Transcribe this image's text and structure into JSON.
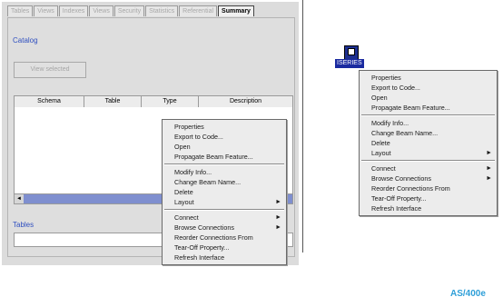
{
  "tabs": [
    {
      "label": "Tables",
      "active": false
    },
    {
      "label": "Views",
      "active": false
    },
    {
      "label": "Indexes",
      "active": false
    },
    {
      "label": "Views",
      "active": false
    },
    {
      "label": "Security",
      "active": false
    },
    {
      "label": "Statistics",
      "active": false
    },
    {
      "label": "Referential",
      "active": false
    },
    {
      "label": "Summary",
      "active": true
    }
  ],
  "panel": {
    "catalog_label": "Catalog",
    "view_selected_button": "View selected",
    "columns": [
      "Schema",
      "Table",
      "Type",
      "Description"
    ],
    "tables_label": "Tables",
    "tables_value": ""
  },
  "left_menu": {
    "groups": [
      [
        "Properties",
        "Export to Code...",
        "Open",
        "Propagate Beam Feature..."
      ],
      [
        "Modify Info...",
        "Change Beam Name...",
        "Delete",
        "Layout"
      ],
      [
        "Connect",
        "Browse Connections",
        "Reorder Connections From",
        "Tear-Off Property...",
        "Refresh Interface"
      ]
    ],
    "submenus": [
      "Layout",
      "Connect",
      "Browse Connections"
    ]
  },
  "desktop_icon": {
    "label": "ISERIES"
  },
  "right_menu": {
    "groups": [
      [
        "Properties",
        "Export to Code...",
        "Open",
        "Propagate Beam Feature..."
      ],
      [
        "Modify Info...",
        "Change Beam Name...",
        "Delete",
        "Layout"
      ],
      [
        "Connect",
        "Browse Connections",
        "Reorder Connections From",
        "Tear-Off Property...",
        "Refresh Interface"
      ]
    ],
    "submenus": [
      "Layout",
      "Connect",
      "Browse Connections"
    ]
  },
  "caption": "AS/400e",
  "colors": {
    "accent_blue": "#1a2aa0",
    "caption_blue": "#2e9fd8",
    "scrollbar_blue": "#7f8fcf"
  }
}
